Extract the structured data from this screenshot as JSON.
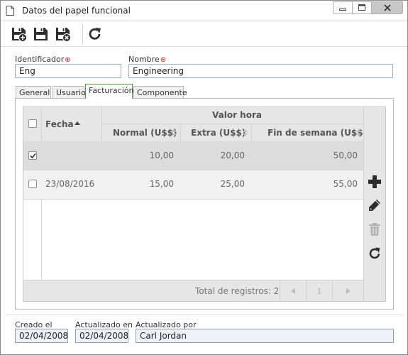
{
  "window": {
    "title": "Datos del papel funcional",
    "icon": "document-icon",
    "controls": [
      "minimize-icon",
      "maximize-icon",
      "close-icon"
    ]
  },
  "toolbar": {
    "buttons": [
      {
        "name": "save-and-new",
        "icon": "save-new-icon"
      },
      {
        "name": "save",
        "icon": "save-icon"
      },
      {
        "name": "save-and-close",
        "icon": "save-close-icon"
      },
      {
        "name": "refresh",
        "icon": "refresh-icon"
      }
    ]
  },
  "form": {
    "identifier_label": "Identificador",
    "identifier_value": "Eng",
    "name_label": "Nombre",
    "name_value": "Engineering",
    "required_mark": "⊕"
  },
  "tabs": [
    {
      "label": "General",
      "active": false
    },
    {
      "label": "Usuario",
      "active": false
    },
    {
      "label": "Facturación",
      "active": true
    },
    {
      "label": "Componente",
      "active": false
    }
  ],
  "grid": {
    "col_date": "Fecha",
    "group_header": "Valor hora",
    "col_normal": "Normal (U$$)",
    "col_extra": "Extra (U$$)",
    "col_weekend": "Fin de semana (U$$)",
    "rows": [
      {
        "checked": true,
        "date": "",
        "normal": "10,00",
        "extra": "20,00",
        "weekend": "50,00"
      },
      {
        "checked": false,
        "date": "23/08/2016",
        "normal": "15,00",
        "extra": "25,00",
        "weekend": "55,00"
      }
    ],
    "total_text": "Total de registros: 2",
    "page_number": "1"
  },
  "side_actions": [
    "add-icon",
    "edit-icon",
    "delete-icon",
    "refresh-icon"
  ],
  "footer": {
    "created_label": "Creado el",
    "created_value": "02/04/2008",
    "updated_label": "Actualizado en",
    "updated_value": "02/04/2008",
    "updated_by_label": "Actualizado por",
    "updated_by_value": "Carl Jordan"
  },
  "colors": {
    "active_tab_border": "#4f9a3c",
    "required": "#d32020",
    "field_border": "#9aaec6",
    "grid_header": "#e6e6e6",
    "selected_row": "#dcdcdc"
  }
}
